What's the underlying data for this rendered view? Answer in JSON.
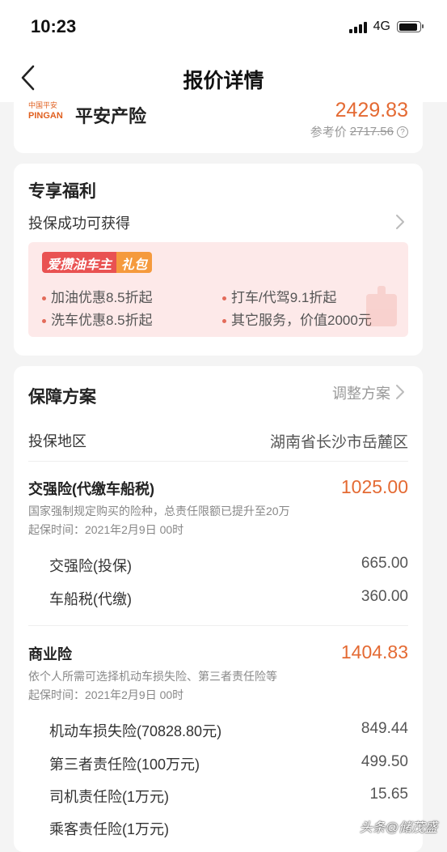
{
  "status": {
    "time": "10:23",
    "network": "4G"
  },
  "nav": {
    "title": "报价详情"
  },
  "quote": {
    "logo_cn": "中国平安",
    "logo_en": "PINGAN",
    "insurer": "平安产险",
    "price": "2429.83",
    "ref_label": "参考价",
    "ref_price": "2717.56"
  },
  "benefits": {
    "title": "专享福利",
    "subtitle": "投保成功可获得",
    "badge_main": "爱攒油车主",
    "badge_tag": "礼包",
    "items": [
      "加油优惠8.5折起",
      "打车/代驾9.1折起",
      "洗车优惠8.5折起",
      "其它服务，价值2000元"
    ]
  },
  "plan": {
    "title": "保障方案",
    "adjust_label": "调整方案",
    "region_label": "投保地区",
    "region_value": "湖南省长沙市岳麓区",
    "compulsory": {
      "title": "交强险(代缴车船税)",
      "price": "1025.00",
      "note": "国家强制规定购买的险种，总责任限额已提升至20万",
      "start": "起保时间：2021年2月9日 00时",
      "items": [
        {
          "label": "交强险(投保)",
          "value": "665.00"
        },
        {
          "label": "车船税(代缴)",
          "value": "360.00"
        }
      ]
    },
    "commercial": {
      "title": "商业险",
      "price": "1404.83",
      "note": "依个人所需可选择机动车损失险、第三者责任险等",
      "start": "起保时间：2021年2月9日 00时",
      "items": [
        {
          "label": "机动车损失险(70828.80元)",
          "value": "849.44"
        },
        {
          "label": "第三者责任险(100万元)",
          "value": "499.50"
        },
        {
          "label": "司机责任险(1万元)",
          "value": "15.65"
        },
        {
          "label": "乘客责任险(1万元)",
          "value": ""
        }
      ]
    }
  },
  "watermark": "头条@储茂盛",
  "colors": {
    "accent": "#e46a33",
    "benefit_bg": "#fde9e9",
    "badge_red": "#e95252",
    "badge_orange": "#f59a3d"
  }
}
